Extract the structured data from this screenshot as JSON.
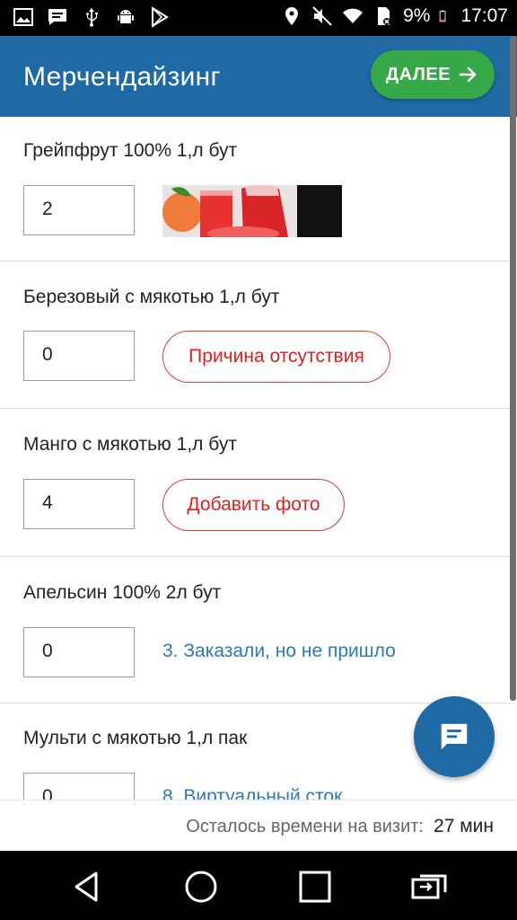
{
  "status_bar": {
    "left_icons": [
      "image-icon",
      "message-icon",
      "usb-icon",
      "android-icon",
      "play-store-icon"
    ],
    "right_icons": [
      "location-icon",
      "mute-icon",
      "wifi-icon",
      "no-sim-icon",
      "battery-icon"
    ],
    "battery_percent": "9%",
    "time": "17:07"
  },
  "app_bar": {
    "title": "Мерчендайзинг",
    "next_label": "ДАЛЕЕ",
    "bg_color": "#1f6aa5",
    "next_color": "#35a847"
  },
  "items": [
    {
      "title": "Грейпфрут 100% 1,л бут",
      "quantity": "2"
    },
    {
      "title": "Березовый с мякотью 1,л бут",
      "quantity": "0",
      "action": "Причина отсутствия"
    },
    {
      "title": "Манго с мякотью 1,л бут",
      "quantity": "4",
      "action": "Добавить фото"
    },
    {
      "title": "Апельсин 100% 2л бут",
      "quantity": "0",
      "status": "3. Заказали, но не пришло"
    },
    {
      "title": "Мульти с мякотью 1,л пак",
      "quantity": "0",
      "status": "8. Виртуальный сток"
    }
  ],
  "footer": {
    "time_left_label": "Осталось времени на визит:",
    "time_left_value": "27 мин"
  },
  "fab": {
    "icon": "chat-icon"
  },
  "nav_bar": {
    "icons": [
      "back-icon",
      "home-icon",
      "recents-icon",
      "switch-icon"
    ]
  }
}
